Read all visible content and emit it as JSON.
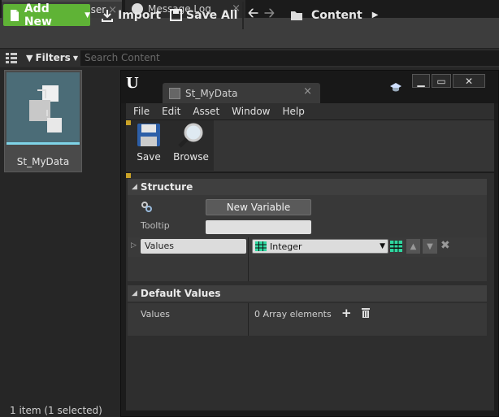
{
  "tabs": [
    {
      "label": "Content Browser"
    },
    {
      "label": "Message Log"
    }
  ],
  "toolbar": {
    "add_new": "Add New",
    "import": "Import",
    "save_all": "Save All",
    "path": "Content"
  },
  "filters": {
    "label": "Filters",
    "search_placeholder": "Search Content"
  },
  "asset": {
    "name": "St_MyData"
  },
  "status": {
    "text": "1 item (1 selected)"
  },
  "editor": {
    "tab_label": "St_MyData",
    "menu": [
      "File",
      "Edit",
      "Asset",
      "Window",
      "Help"
    ],
    "toolbar": {
      "save": "Save",
      "browse": "Browse"
    },
    "structure": {
      "title": "Structure",
      "new_variable": "New Variable",
      "tooltip_label": "Tooltip",
      "tooltip_value": "",
      "variable_name": "Values",
      "variable_type": "Integer"
    },
    "default_values": {
      "title": "Default Values",
      "label": "Values",
      "count": "0 Array elements"
    }
  },
  "colors": {
    "accent_green": "#5fb336",
    "type_integer": "#2fd7a0",
    "asset_underline": "#7fd4e8"
  }
}
